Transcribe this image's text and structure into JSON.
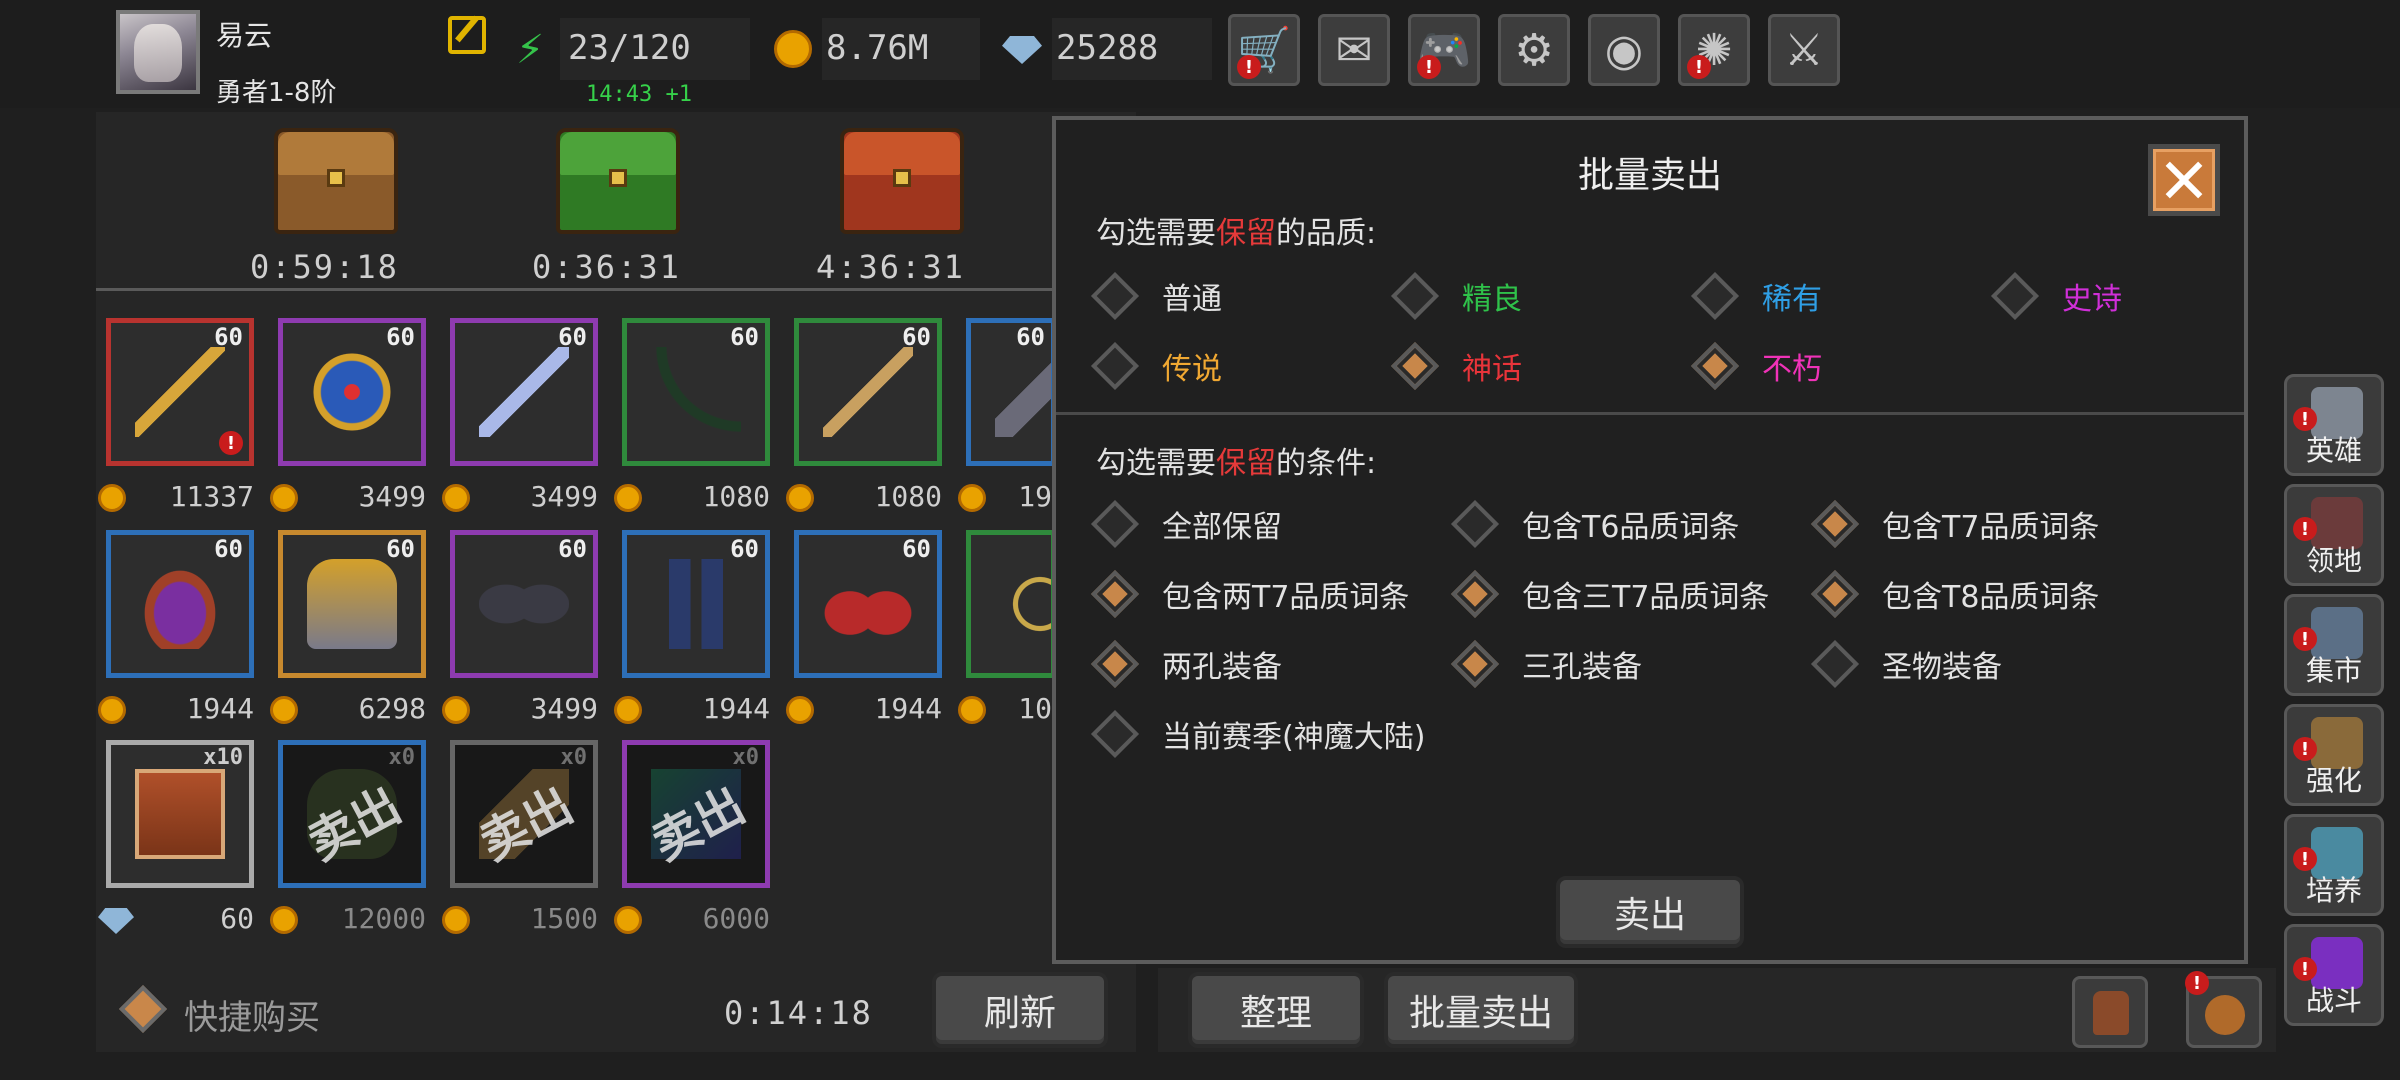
{
  "player": {
    "name": "易云",
    "rank": "勇者1-8阶"
  },
  "resources": {
    "stamina": "23/120",
    "stamina_timer": "14:43 +1",
    "gold": "8.76M",
    "gems": "25288"
  },
  "top_buttons": [
    {
      "name": "shop-button",
      "icon": "🛒",
      "alert": true
    },
    {
      "name": "mail-button",
      "icon": "✉",
      "alert": false
    },
    {
      "name": "gamepad-button",
      "icon": "🎮",
      "alert": true
    },
    {
      "name": "settings-button",
      "icon": "⚙",
      "alert": false
    },
    {
      "name": "color-wheel-button",
      "icon": "◉",
      "alert": false
    },
    {
      "name": "fireworks-button",
      "icon": "✺",
      "alert": true
    },
    {
      "name": "swords-button",
      "icon": "⚔",
      "alert": false
    }
  ],
  "chests": [
    {
      "timer": "0:59:18",
      "color": "#8a5a2a",
      "lid": "#b07a3a"
    },
    {
      "timer": "0:36:31",
      "color": "#2f7a24",
      "lid": "#4da33a"
    },
    {
      "timer": "4:36:31",
      "color": "#a0361e",
      "lid": "#c9552a"
    }
  ],
  "shop_rows": [
    [
      {
        "level": "60",
        "price": "11337",
        "border": "#b8332f",
        "art": "staff",
        "alert": true
      },
      {
        "level": "60",
        "price": "3499",
        "border": "#8e3bb0",
        "art": "shield"
      },
      {
        "level": "60",
        "price": "3499",
        "border": "#8e3bb0",
        "art": "dagger"
      },
      {
        "level": "60",
        "price": "1080",
        "border": "#2f8a3c",
        "art": "bow"
      },
      {
        "level": "60",
        "price": "1080",
        "border": "#2f8a3c",
        "art": "sword"
      },
      {
        "level": "60",
        "price": "19",
        "border": "#2d6fb8",
        "art": "axe"
      }
    ],
    [
      {
        "level": "60",
        "price": "1944",
        "border": "#2d6fb8",
        "art": "helmet"
      },
      {
        "level": "60",
        "price": "6298",
        "border": "#c7892e",
        "art": "armor"
      },
      {
        "level": "60",
        "price": "3499",
        "border": "#8e3bb0",
        "art": "gloves"
      },
      {
        "level": "60",
        "price": "1944",
        "border": "#2d6fb8",
        "art": "legs"
      },
      {
        "level": "60",
        "price": "1944",
        "border": "#2d6fb8",
        "art": "boots"
      },
      {
        "level": "",
        "price": "10",
        "border": "#2f8a3c",
        "art": "amulet"
      }
    ],
    [
      {
        "qty": "x10",
        "price": "60",
        "border": "#aaaaaa",
        "art": "book",
        "currency": "gem"
      },
      {
        "qty": "x0",
        "price": "12000",
        "border": "#2d6fb8",
        "art": "sack",
        "sold": "卖出"
      },
      {
        "qty": "x0",
        "price": "1500",
        "border": "#666666",
        "art": "scroll",
        "sold": "卖出"
      },
      {
        "qty": "x0",
        "price": "6000",
        "border": "#8e3bb0",
        "art": "tome",
        "sold": "卖出"
      }
    ]
  ],
  "bottom": {
    "quick_buy": "快捷购买",
    "timer": "0:14:18",
    "refresh": "刷新",
    "organize": "整理",
    "bulk_sell": "批量卖出"
  },
  "sidebar": [
    {
      "label": "英雄",
      "name": "hero",
      "color": "#7d8590"
    },
    {
      "label": "领地",
      "name": "territory",
      "color": "#6b3b3b"
    },
    {
      "label": "集市",
      "name": "market",
      "color": "#5b6f86"
    },
    {
      "label": "强化",
      "name": "enhance",
      "color": "#8a6a3a"
    },
    {
      "label": "培养",
      "name": "cultivate",
      "color": "#4a8aa0"
    },
    {
      "label": "战斗",
      "name": "battle",
      "color": "#7a2fc0"
    }
  ],
  "dialog": {
    "title": "批量卖出",
    "quality_label": {
      "before": "勾选需要",
      "highlight": "保留",
      "after": "的品质:"
    },
    "qualities": [
      {
        "label": "普通",
        "color": "#e2e2e2",
        "checked": false
      },
      {
        "label": "精良",
        "color": "#2fc24a",
        "checked": false
      },
      {
        "label": "稀有",
        "color": "#2f9fe6",
        "checked": false
      },
      {
        "label": "史诗",
        "color": "#d02fd8",
        "checked": false
      },
      {
        "label": "传说",
        "color": "#f0a832",
        "checked": false
      },
      {
        "label": "神话",
        "color": "#e8343a",
        "checked": true
      },
      {
        "label": "不朽",
        "color": "#f032b8",
        "checked": true
      }
    ],
    "condition_label": {
      "before": "勾选需要",
      "highlight": "保留",
      "after": "的条件:"
    },
    "conditions": [
      {
        "label": "全部保留",
        "checked": false
      },
      {
        "label": "包含T6品质词条",
        "checked": false
      },
      {
        "label": "包含T7品质词条",
        "checked": true
      },
      {
        "label": "包含两T7品质词条",
        "checked": true
      },
      {
        "label": "包含三T7品质词条",
        "checked": true
      },
      {
        "label": "包含T8品质词条",
        "checked": true
      },
      {
        "label": "两孔装备",
        "checked": true
      },
      {
        "label": "三孔装备",
        "checked": true
      },
      {
        "label": "圣物装备",
        "checked": false
      },
      {
        "label": "当前赛季(神魔大陆)",
        "checked": false
      }
    ],
    "sell_button": "卖出"
  }
}
